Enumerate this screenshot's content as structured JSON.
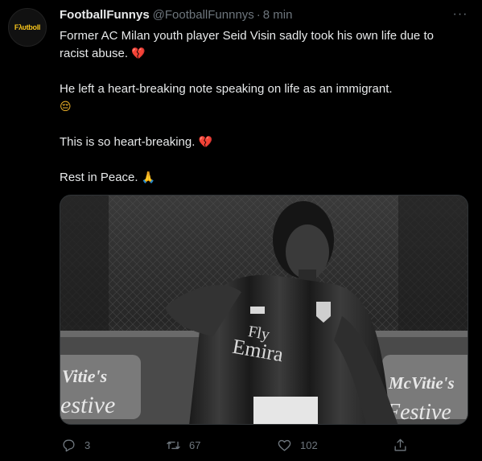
{
  "author": {
    "display_name": "FootballFunnys",
    "handle": "@FootballFunnnys",
    "separator": "·",
    "timestamp": "8 min",
    "avatar_text": "Fλυtbοll"
  },
  "menu": {
    "more_icon": "ellipsis-icon",
    "label": "···"
  },
  "body": {
    "line1": "Former AC Milan youth player Seid Visin sadly took his own life due to racist abuse.",
    "line2": "He left a heart-breaking note speaking on life as an immigrant.",
    "line3": "This is so heart-breaking.",
    "line4": "Rest in Peace.",
    "emoji_broken_heart": "💔",
    "emoji_pensive": "😔",
    "emoji_pray": "🙏"
  },
  "media": {
    "alt": "Black and white photo of a young footballer in an AC Milan kit",
    "shirt_sponsor": "Fly Emirates",
    "board_left": "Vitie's estive",
    "board_right": "McVitie's Festive"
  },
  "actions": {
    "reply_count": "3",
    "retweet_count": "67",
    "like_count": "102",
    "reply_icon": "reply-icon",
    "retweet_icon": "retweet-icon",
    "like_icon": "heart-icon",
    "share_icon": "share-icon"
  },
  "colors": {
    "background": "#000000",
    "text": "#e7e9ea",
    "secondary": "#6e767d",
    "border": "#2f3336"
  }
}
